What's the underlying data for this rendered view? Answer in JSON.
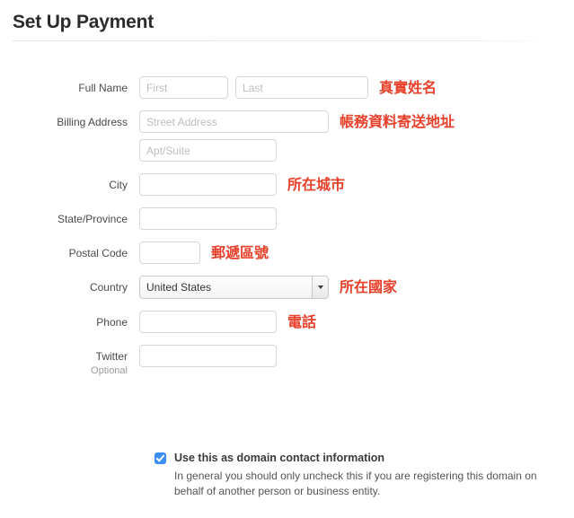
{
  "page": {
    "title": "Set Up Payment"
  },
  "form": {
    "rows": [
      {
        "label": "Full Name",
        "inputs": [
          {
            "name": "first-name-input",
            "placeholder": "First"
          },
          {
            "name": "last-name-input",
            "placeholder": "Last"
          }
        ],
        "note": "真實姓名"
      },
      {
        "label": "Billing Address",
        "inputs": [
          {
            "name": "street-address-input",
            "placeholder": "Street Address"
          }
        ],
        "note": "帳務資料寄送地址"
      },
      {
        "label": "",
        "inputs": [
          {
            "name": "apt-suite-input",
            "placeholder": "Apt/Suite"
          }
        ],
        "note": ""
      },
      {
        "label": "City",
        "inputs": [
          {
            "name": "city-input",
            "placeholder": ""
          }
        ],
        "note": "所在城市"
      },
      {
        "label": "State/Province",
        "inputs": [
          {
            "name": "state-province-input",
            "placeholder": ""
          }
        ],
        "note": ""
      },
      {
        "label": "Postal Code",
        "inputs": [
          {
            "name": "postal-code-input",
            "placeholder": ""
          }
        ],
        "note": "郵遞區號"
      },
      {
        "label": "Country",
        "select": {
          "name": "country-select",
          "value": "United States",
          "options": [
            "United States"
          ]
        },
        "note": "所在國家"
      },
      {
        "label": "Phone",
        "inputs": [
          {
            "name": "phone-input",
            "placeholder": ""
          }
        ],
        "note": "電話"
      },
      {
        "label": "Twitter",
        "sublabel": "Optional",
        "inputs": [
          {
            "name": "twitter-input",
            "placeholder": ""
          }
        ],
        "note": ""
      }
    ]
  },
  "domain_contact": {
    "checked": true,
    "title": "Use this as domain contact information",
    "help": "In general you should only uncheck this if you are registering this domain on behalf of another person or business entity."
  },
  "colors": {
    "annotation_red": "#e8402a",
    "checkbox_blue": "#3e8ef7",
    "title_dark": "#2b2b2b",
    "label_gray": "#4a4a4a",
    "placeholder_gray": "#bdbdbd",
    "border_gray": "#d6d6d6"
  }
}
